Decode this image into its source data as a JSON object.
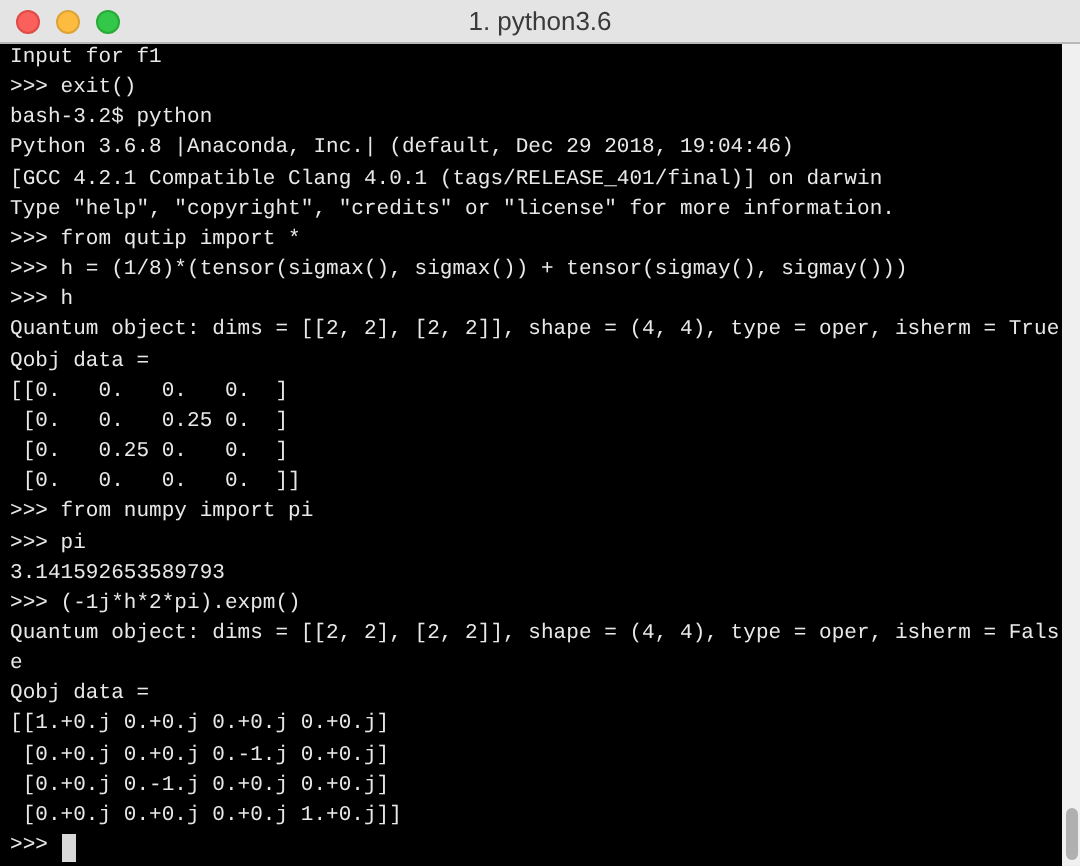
{
  "window": {
    "title": "1. python3.6"
  },
  "terminal": {
    "lines": [
      "Input for f1",
      ">>> exit()",
      "bash-3.2$ python",
      "Python 3.6.8 |Anaconda, Inc.| (default, Dec 29 2018, 19:04:46)",
      "[GCC 4.2.1 Compatible Clang 4.0.1 (tags/RELEASE_401/final)] on darwin",
      "Type \"help\", \"copyright\", \"credits\" or \"license\" for more information.",
      ">>> from qutip import *",
      ">>> h = (1/8)*(tensor(sigmax(), sigmax()) + tensor(sigmay(), sigmay()))",
      ">>> h",
      "Quantum object: dims = [[2, 2], [2, 2]], shape = (4, 4), type = oper, isherm = True",
      "Qobj data =",
      "[[0.   0.   0.   0.  ]",
      " [0.   0.   0.25 0.  ]",
      " [0.   0.25 0.   0.  ]",
      " [0.   0.   0.   0.  ]]",
      ">>> from numpy import pi",
      ">>> pi",
      "3.141592653589793",
      ">>> (-1j*h*2*pi).expm()",
      "Quantum object: dims = [[2, 2], [2, 2]], shape = (4, 4), type = oper, isherm = Fals",
      "e",
      "Qobj data =",
      "[[1.+0.j 0.+0.j 0.+0.j 0.+0.j]",
      " [0.+0.j 0.+0.j 0.-1.j 0.+0.j]",
      " [0.+0.j 0.-1.j 0.+0.j 0.+0.j]",
      " [0.+0.j 0.+0.j 0.+0.j 1.+0.j]]"
    ],
    "prompt": ">>>"
  }
}
